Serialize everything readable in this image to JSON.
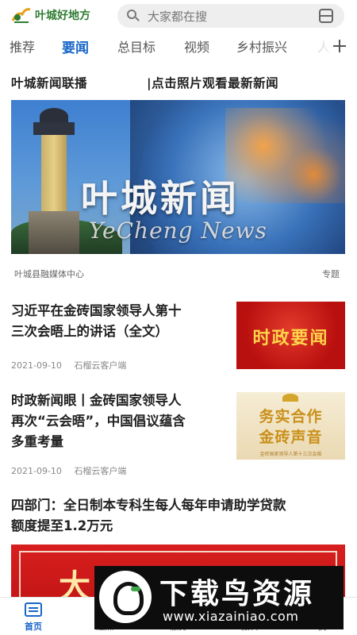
{
  "header": {
    "logo_text": "叶城好地方",
    "search_placeholder": "大家都在搜"
  },
  "tabs": [
    {
      "label": "推荐",
      "active": false
    },
    {
      "label": "要闻",
      "active": true
    },
    {
      "label": "总目标",
      "active": false
    },
    {
      "label": "视频",
      "active": false
    },
    {
      "label": "乡村振兴",
      "active": false
    },
    {
      "label": "人",
      "active": false
    }
  ],
  "section": {
    "title": "叶城新闻联播",
    "link": "|点击照片观看最新新闻"
  },
  "banner": {
    "title": "叶城新闻",
    "subtitle": "YeCheng News",
    "source": "叶城县融媒体中心",
    "tag": "专题"
  },
  "news": [
    {
      "title_line1": "习近平在金砖国家领导人第十",
      "title_line2": "三次会晤上的讲话（全文）",
      "date": "2021-09-10",
      "source": "石榴云客户端",
      "thumb_text": "时政要闻"
    },
    {
      "title_line1": "时政新闻眼丨金砖国家领导人",
      "title_line2": "再次“云会晤”，中国倡议蕴含",
      "title_line3": "多重考量",
      "date": "2021-09-10",
      "source": "石榴云客户端",
      "thumb_text_1": "务实合作",
      "thumb_text_2": "金砖声音",
      "thumb_caption": "金砖国家领导人第十三次会晤"
    },
    {
      "title_line1": "四部门：全日制本专科生每人每年申请助学贷款",
      "title_line2": "额度提至1.2万元",
      "image_text": "大"
    }
  ],
  "bottom_nav": [
    {
      "label": "首页",
      "active": true
    },
    {
      "label": "融媒",
      "active": false
    },
    {
      "label": "服务",
      "active": false
    },
    {
      "label": "报料",
      "active": false
    },
    {
      "label": "我",
      "active": false
    }
  ],
  "watermark": {
    "title": "下载鸟资源",
    "url": "www.xiazainiao.com"
  },
  "colors": {
    "accent": "#1a66c8",
    "logo_green": "#2f7d32",
    "news_red": "#c21414"
  }
}
